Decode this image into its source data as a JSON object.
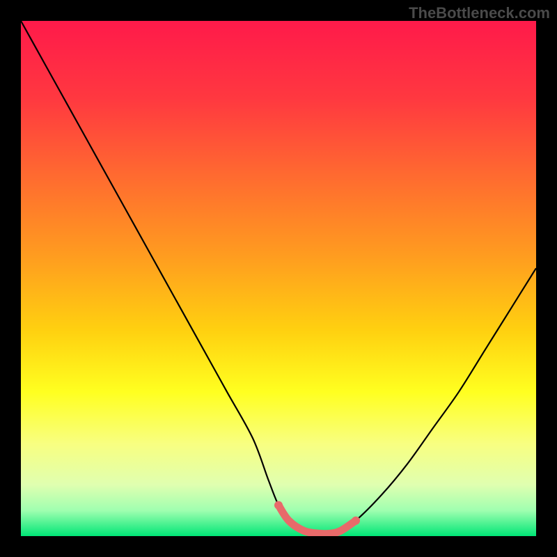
{
  "watermark": "TheBottleneck.com",
  "chart_data": {
    "type": "line",
    "title": "",
    "xlabel": "",
    "ylabel": "",
    "xlim": [
      0,
      100
    ],
    "ylim": [
      0,
      100
    ],
    "series": [
      {
        "name": "bottleneck-curve",
        "x": [
          0,
          5,
          10,
          15,
          20,
          25,
          30,
          35,
          40,
          45,
          48,
          50,
          52,
          55,
          58,
          60,
          62,
          65,
          70,
          75,
          80,
          85,
          90,
          95,
          100
        ],
        "y": [
          100,
          91,
          82,
          73,
          64,
          55,
          46,
          37,
          28,
          19,
          11,
          6,
          3,
          1,
          0.5,
          0.5,
          1,
          3,
          8,
          14,
          21,
          28,
          36,
          44,
          52
        ]
      }
    ],
    "highlight_region": {
      "name": "optimal-zone",
      "x": [
        50,
        52,
        55,
        58,
        60,
        62,
        65
      ],
      "y": [
        6,
        3,
        1,
        0.5,
        0.5,
        1,
        3
      ],
      "color": "#e86a6a"
    },
    "gradient_stops": [
      {
        "offset": 0,
        "color": "#ff1a4a"
      },
      {
        "offset": 15,
        "color": "#ff3840"
      },
      {
        "offset": 30,
        "color": "#ff6a30"
      },
      {
        "offset": 45,
        "color": "#ff9a20"
      },
      {
        "offset": 60,
        "color": "#ffd010"
      },
      {
        "offset": 72,
        "color": "#ffff20"
      },
      {
        "offset": 82,
        "color": "#f8ff80"
      },
      {
        "offset": 90,
        "color": "#e0ffb0"
      },
      {
        "offset": 95,
        "color": "#a0ffb0"
      },
      {
        "offset": 100,
        "color": "#00e676"
      }
    ]
  }
}
